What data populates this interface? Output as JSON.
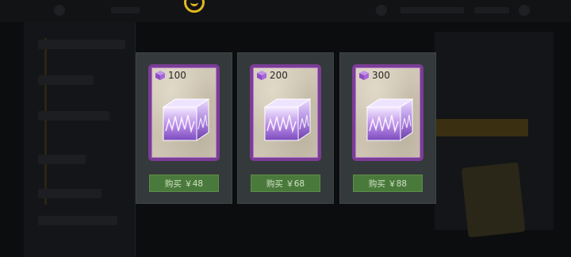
{
  "shop": {
    "items": [
      {
        "quantity": "100",
        "price_label": "购买 ￥48"
      },
      {
        "quantity": "200",
        "price_label": "购买 ￥68"
      },
      {
        "quantity": "300",
        "price_label": "购买 ￥88"
      }
    ]
  },
  "icons": {
    "currency": "purple-cube-icon",
    "item_image": "crystal-cube-icon",
    "top_logo": "gold-smiley-icon"
  },
  "colors": {
    "card_bg": "#34393b",
    "frame_border": "#7b3d95",
    "buy_button": "#4a7a3b",
    "gem_purple": "#9b5cc9",
    "logo_gold": "#e0b820"
  }
}
